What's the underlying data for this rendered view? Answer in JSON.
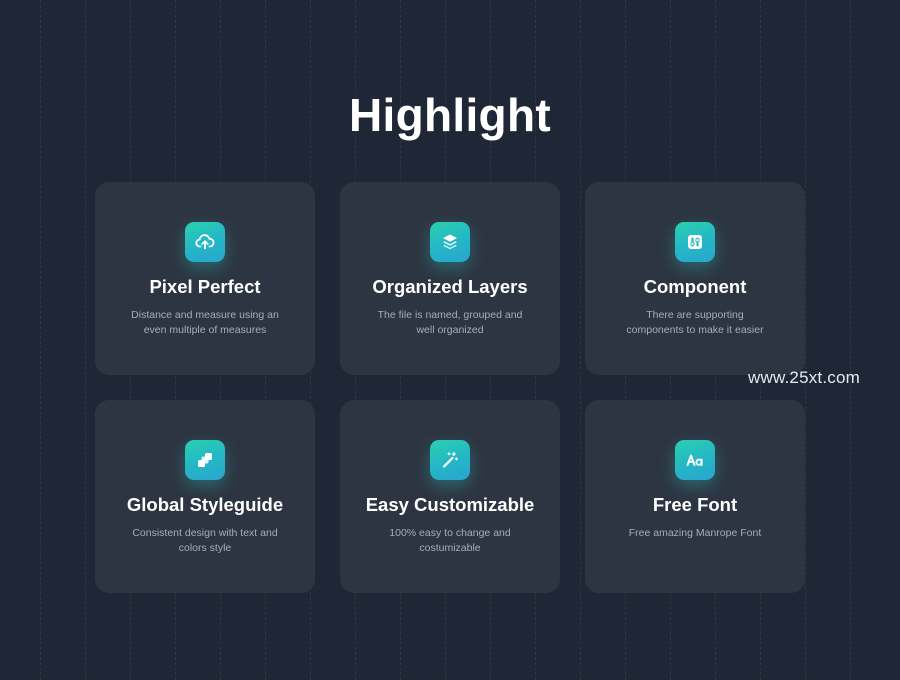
{
  "page": {
    "title": "Highlight"
  },
  "theme": {
    "background": "#1f2736",
    "card": "#2d3542",
    "accent_start": "#2ad0b0",
    "accent_end": "#2aa5d0"
  },
  "cards": [
    {
      "title": "Pixel Perfect",
      "description": "Distance and measure using an even multiple of measures",
      "icon": "upload-cloud-icon"
    },
    {
      "title": "Organized Layers",
      "description": "The file is named, grouped and well organized",
      "icon": "layers-icon"
    },
    {
      "title": "Component",
      "description": "There are supporting components to make it easier",
      "icon": "component-icon"
    },
    {
      "title": "Global Styleguide",
      "description": "Consistent design with text and colors style",
      "icon": "styleguide-icon"
    },
    {
      "title": "Easy Customizable",
      "description": "100% easy to change and costumizable",
      "icon": "magic-wand-icon"
    },
    {
      "title": "Free Font",
      "description": "Free amazing Manrope  Font",
      "icon": "font-aa-icon"
    }
  ],
  "watermark": "www.25xt.com"
}
